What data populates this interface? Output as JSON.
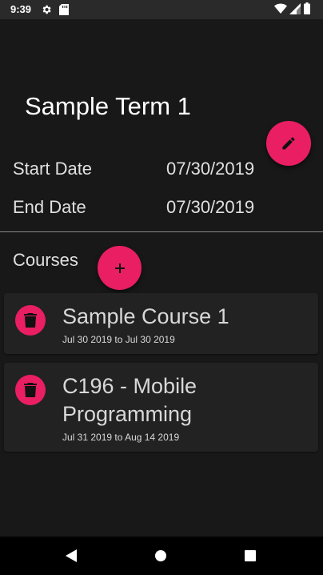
{
  "status_bar": {
    "time": "9:39",
    "icons": [
      "gear-icon",
      "sd-card-icon",
      "wifi-icon",
      "signal-icon",
      "battery-icon"
    ]
  },
  "term": {
    "title": "Sample Term 1",
    "start_label": "Start Date",
    "start_value": "07/30/2019",
    "end_label": "End Date",
    "end_value": "07/30/2019"
  },
  "courses_label": "Courses",
  "courses": [
    {
      "title": "Sample Course 1",
      "dates": "Jul 30 2019 to Jul 30 2019"
    },
    {
      "title": "C196 - Mobile Programming",
      "dates": "Jul 31 2019 to Aug 14 2019"
    }
  ],
  "colors": {
    "accent": "#e91e63",
    "background": "#181818",
    "card": "#222222"
  },
  "nav": [
    "back-icon",
    "home-icon",
    "recents-icon"
  ]
}
